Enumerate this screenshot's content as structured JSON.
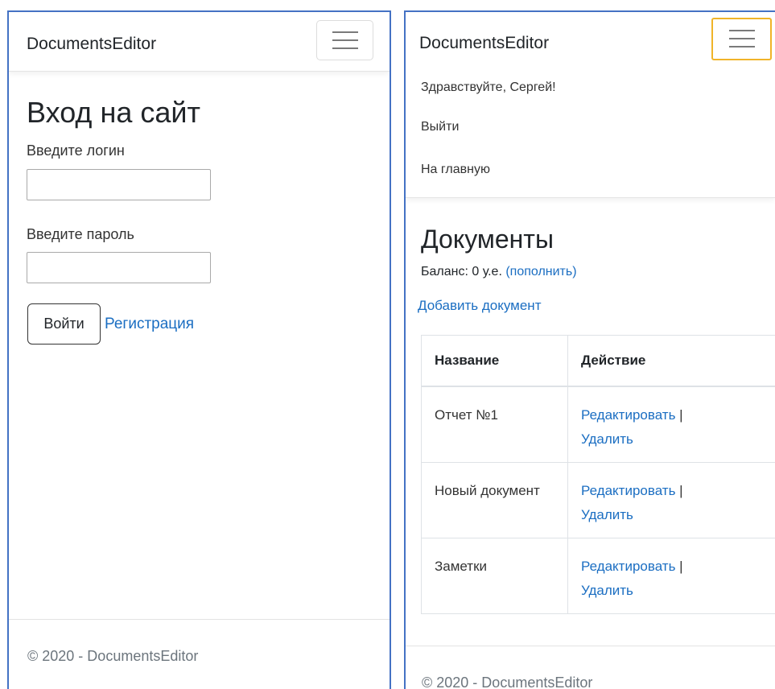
{
  "left": {
    "brand": "DocumentsEditor",
    "title": "Вход на сайт",
    "login_label": "Введите логин",
    "login_value": "",
    "password_label": "Введите пароль",
    "password_value": "",
    "login_button": "Войти",
    "register_link": "Регистрация",
    "footer": "© 2020 - DocumentsEditor"
  },
  "right": {
    "brand": "DocumentsEditor",
    "greeting": "Здравствуйте, Сергей!",
    "logout": "Выйти",
    "home": "На главную",
    "title": "Документы",
    "balance_label": "Баланс: 0 у.е.",
    "topup_link": "(пополнить)",
    "add_document": "Добавить документ",
    "table": {
      "headers": [
        "Название",
        "Действие"
      ],
      "rows": [
        {
          "name": "Отчет №1",
          "edit": "Редактировать",
          "separator": "|",
          "delete": "Удалить"
        },
        {
          "name": "Новый документ",
          "edit": "Редактировать",
          "separator": "|",
          "delete": "Удалить"
        },
        {
          "name": "Заметки",
          "edit": "Редактировать",
          "separator": "|",
          "delete": "Удалить"
        }
      ]
    },
    "footer": "© 2020 - DocumentsEditor"
  },
  "colors": {
    "link": "#1b6ec2",
    "panel_border": "#4472c4",
    "toggler_focus": "#f0b429",
    "muted_text": "#6c757d"
  },
  "icons": [
    "hamburger-menu-icon"
  ]
}
